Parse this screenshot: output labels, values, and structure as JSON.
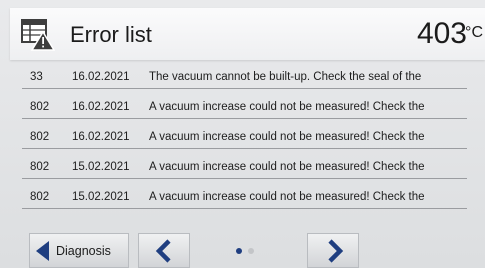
{
  "header": {
    "title": "Error list",
    "temperature": "403",
    "temperature_unit": "°C"
  },
  "errors": [
    {
      "code": "33",
      "date": "16.02.2021",
      "message": "The vacuum cannot be built-up. Check the seal of the"
    },
    {
      "code": "802",
      "date": "16.02.2021",
      "message": "A vacuum increase could not be measured! Check the"
    },
    {
      "code": "802",
      "date": "16.02.2021",
      "message": "A vacuum increase could not be measured! Check the"
    },
    {
      "code": "802",
      "date": "15.02.2021",
      "message": "A vacuum increase could not be measured! Check the"
    },
    {
      "code": "802",
      "date": "15.02.2021",
      "message": "A vacuum increase could not be measured! Check the"
    }
  ],
  "footer": {
    "diagnosis_label": "Diagnosis",
    "page_current": 1,
    "page_count": 2
  },
  "colors": {
    "accent": "#1f3e80",
    "header_bg": "#f5f6f7",
    "screen_bg": "#e2e4e6"
  },
  "icons": {
    "header": "error-list-icon",
    "back": "triangle-left-icon",
    "prev": "chevron-left-icon",
    "next": "chevron-right-icon"
  }
}
